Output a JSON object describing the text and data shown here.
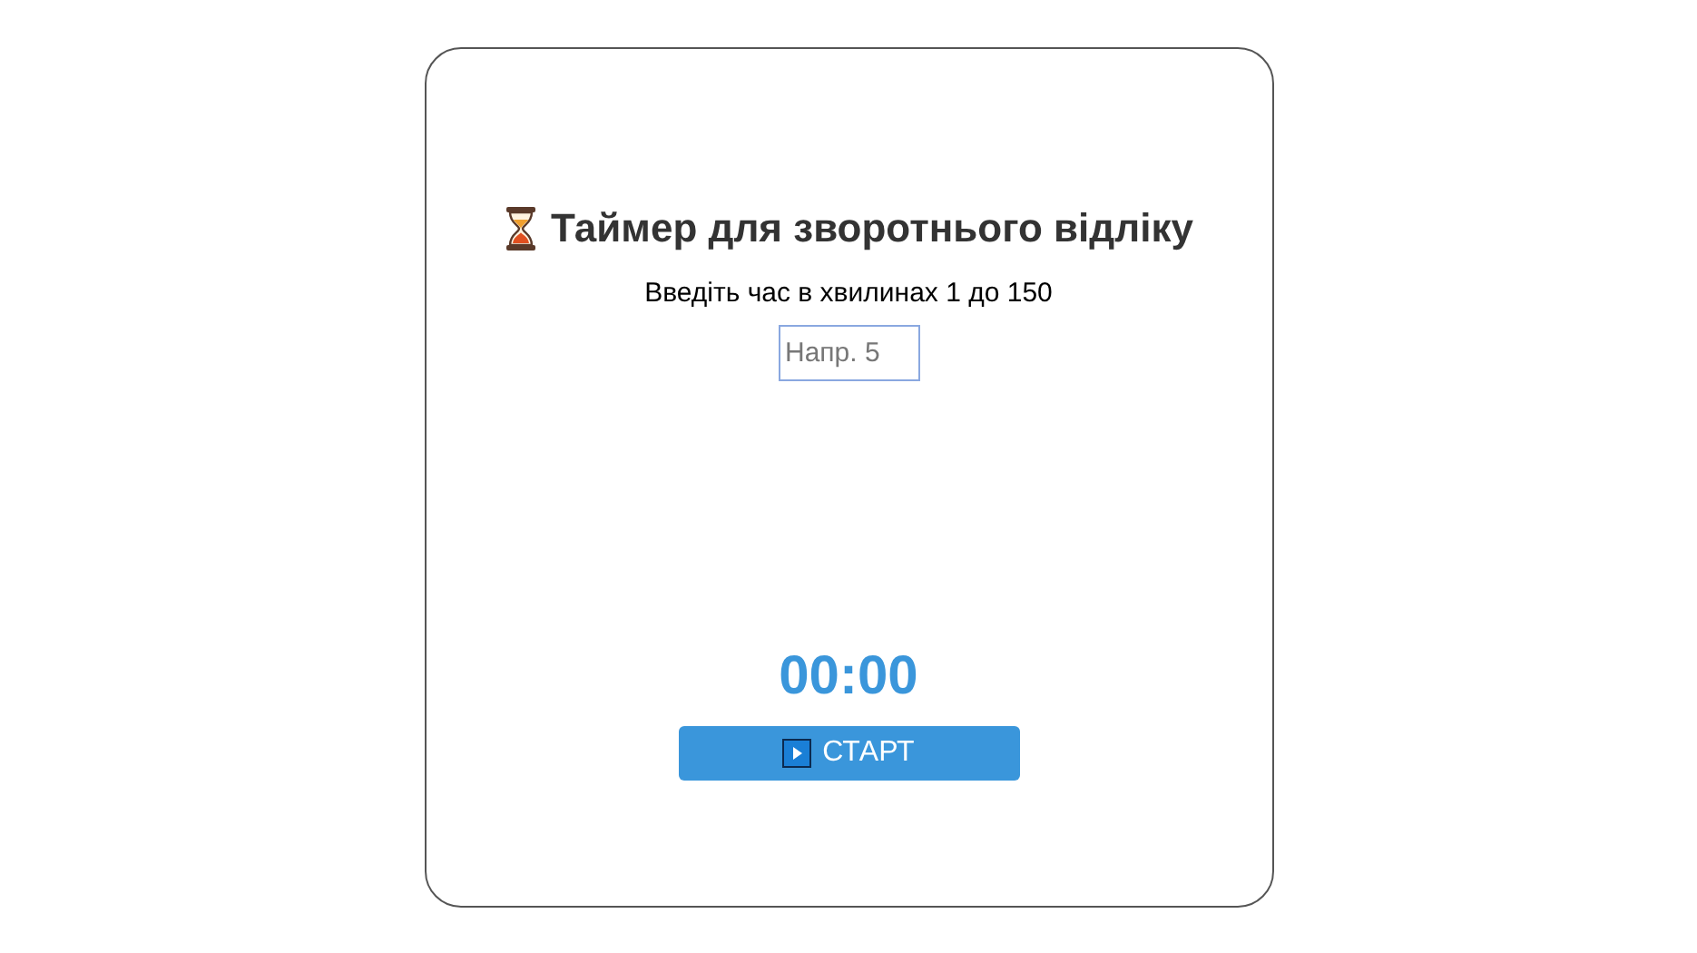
{
  "title": "Таймер для зворотнього відліку",
  "prompt": "Введіть час в хвилинах 1 до 150",
  "minutes_field": {
    "placeholder": "Напр. 5"
  },
  "time_display": "00:00",
  "start_button": {
    "label": "СТАРТ"
  }
}
